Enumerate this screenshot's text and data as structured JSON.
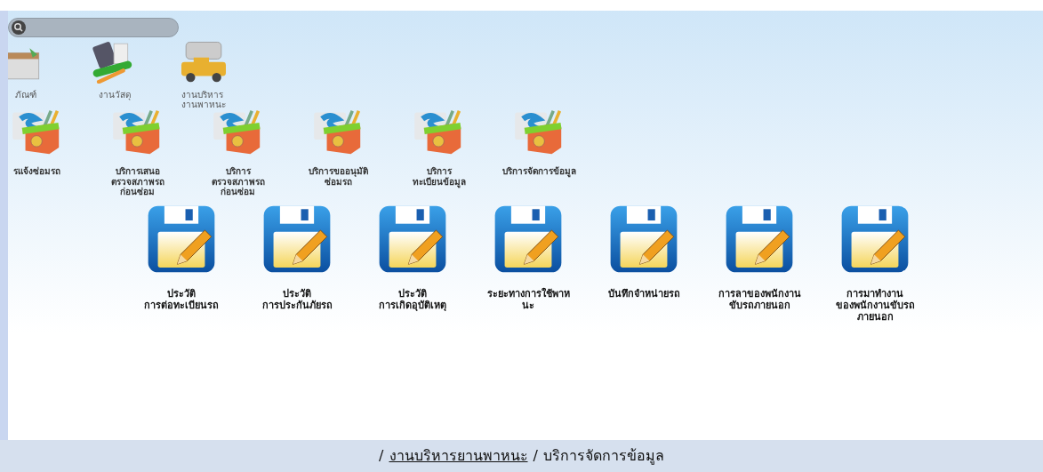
{
  "top_apps": [
    {
      "label": "ภัณฑ์",
      "kind": "equipment"
    },
    {
      "label": "งานวัสดุ",
      "kind": "supplies"
    },
    {
      "label": "งานบริหาร\nงานพาหนะ",
      "kind": "vehicles"
    }
  ],
  "services": [
    {
      "label": "รแจ้งซ่อมรถ"
    },
    {
      "label": "บริการเสนอ\nตรวจสภาพรถ\nก่อนซ่อม"
    },
    {
      "label": "บริการ\nตรวจสภาพรถ\nก่อนซ่อม"
    },
    {
      "label": "บริการขออนุมัติ\nซ่อมรถ"
    },
    {
      "label": "บริการ\nทะเบียนข้อมูล"
    },
    {
      "label": "บริการจัดการข้อมูล"
    }
  ],
  "records": [
    {
      "label": "ประวัติ\nการต่อทะเบียนรถ"
    },
    {
      "label": "ประวัติ\nการประกันภัยรถ"
    },
    {
      "label": "ประวัติ\nการเกิดอุบัติเหตุ"
    },
    {
      "label": "ระยะทางการใช้พาห\nนะ"
    },
    {
      "label": "บันทึกจำหน่ายรถ"
    },
    {
      "label": "การลาของพนักงาน\nขับรถภายนอก"
    },
    {
      "label": "การมาทำงาน\nของพนักงานขับรถ\nภายนอก"
    }
  ],
  "breadcrumb": [
    {
      "text": "/",
      "kind": "sep"
    },
    {
      "text": "งานบริหารยานพาหนะ",
      "kind": "link"
    },
    {
      "text": "/",
      "kind": "sep"
    },
    {
      "text": "บริการจัดการข้อมูล",
      "kind": "current"
    }
  ]
}
